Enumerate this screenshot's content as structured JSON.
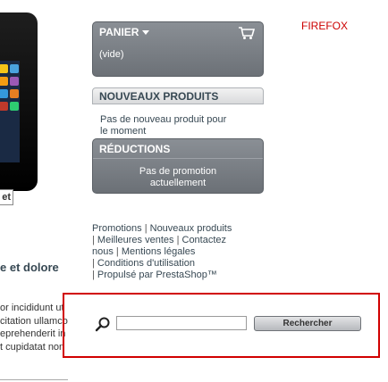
{
  "browser_note": "FIREFOX",
  "product": {
    "image_label": "et",
    "title": "e et dolore",
    "description_lines": [
      "or incididunt ut",
      "citation ullamco",
      "eprehenderit in",
      "t cupidatat non"
    ]
  },
  "cart": {
    "title": "PANIER",
    "empty_text": "(vide)"
  },
  "new_products": {
    "title": "NOUVEAUX PRODUITS",
    "body_line1": "Pas de nouveau produit pour",
    "body_line2": "le moment"
  },
  "discounts": {
    "title": "RÉDUCTIONS",
    "body_line1": "Pas de promotion",
    "body_line2": "actuellement"
  },
  "footer": {
    "promotions": "Promotions",
    "new_products": "Nouveaux produits",
    "best_sales": "Meilleures ventes",
    "contact_line1": "Contactez",
    "contact_line2": "nous",
    "legal": "Mentions légales",
    "terms": "Conditions d'utilisation",
    "powered": "Propulsé par PrestaShop™"
  },
  "search": {
    "value": "",
    "button_label": "Rechercher"
  },
  "colors": {
    "block_bg": "#7d8288",
    "highlight_border": "#d10000",
    "note_text": "#cc0000"
  }
}
